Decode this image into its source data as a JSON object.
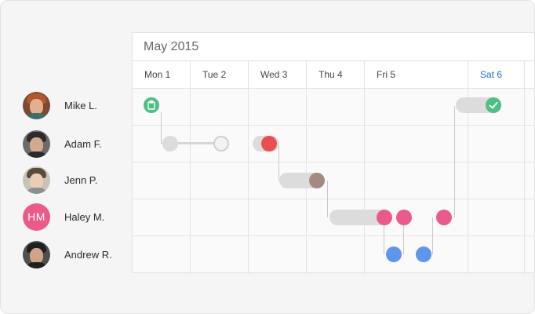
{
  "calendar": {
    "month_title": "May 2015",
    "days": [
      {
        "label": "Mon 1",
        "today": false
      },
      {
        "label": "Tue 2",
        "today": false
      },
      {
        "label": "Wed 3",
        "today": false
      },
      {
        "label": "Thu 4",
        "today": false
      },
      {
        "label": "Fri 5",
        "today": false
      },
      {
        "label": "Sat 6",
        "today": true
      }
    ]
  },
  "people": [
    {
      "name": "Mike L.",
      "avatar": "photo"
    },
    {
      "name": "Adam F.",
      "avatar": "photo"
    },
    {
      "name": "Jenn P.",
      "avatar": "photo"
    },
    {
      "name": "Haley M.",
      "avatar": "initials",
      "initials": "HM"
    },
    {
      "name": "Andrew R.",
      "avatar": "photo"
    }
  ],
  "colors": {
    "accent_today": "#1a73c8",
    "task_red": "#e8504f",
    "task_taupe": "#a28b80",
    "task_pink": "#ec5a8a",
    "task_blue": "#5e96ee",
    "task_done_green": "#4cbf84",
    "task_pending_grey": "#dcdcdc"
  },
  "icons": {
    "start_marker": "clipboard-icon",
    "end_marker": "checkmark-icon"
  }
}
